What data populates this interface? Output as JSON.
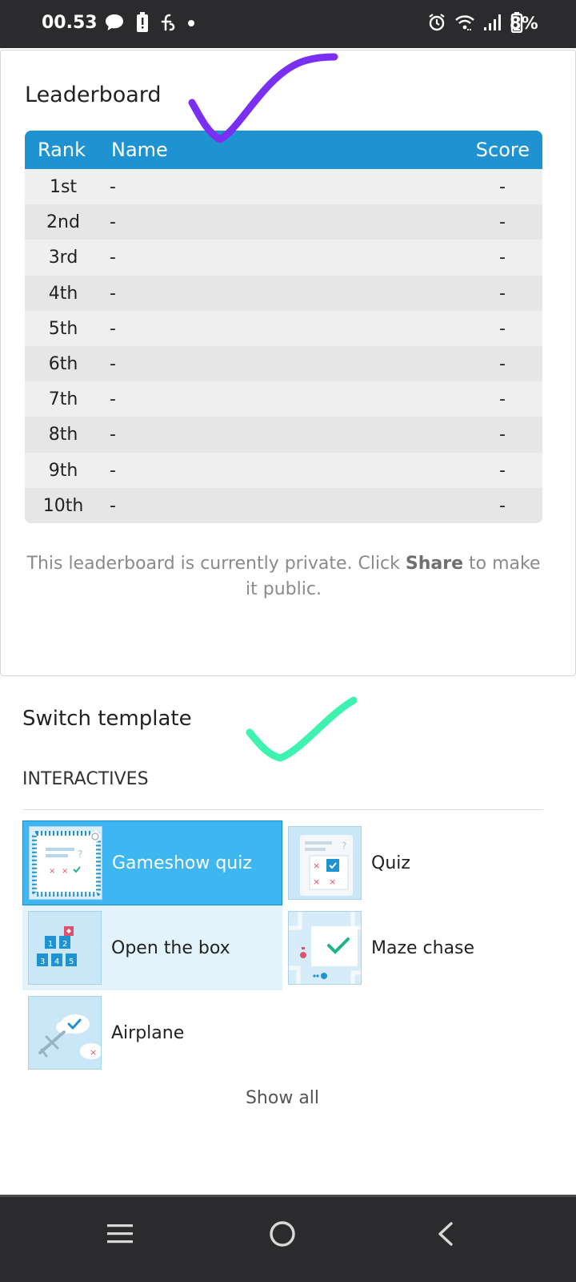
{
  "status_bar": {
    "time": "00.53",
    "battery_percent": "8%",
    "left_icons": [
      "chat-bubble-icon",
      "battery-alert-icon",
      "app-icon",
      "dot-icon"
    ],
    "right_icons": [
      "alarm-icon",
      "wifi-icon",
      "signal-icon",
      "battery-icon"
    ]
  },
  "leaderboard": {
    "title": "Leaderboard",
    "columns": {
      "rank": "Rank",
      "name": "Name",
      "score": "Score"
    },
    "rows": [
      {
        "rank": "1st",
        "name": "-",
        "score": "-"
      },
      {
        "rank": "2nd",
        "name": "-",
        "score": "-"
      },
      {
        "rank": "3rd",
        "name": "-",
        "score": "-"
      },
      {
        "rank": "4th",
        "name": "-",
        "score": "-"
      },
      {
        "rank": "5th",
        "name": "-",
        "score": "-"
      },
      {
        "rank": "6th",
        "name": "-",
        "score": "-"
      },
      {
        "rank": "7th",
        "name": "-",
        "score": "-"
      },
      {
        "rank": "8th",
        "name": "-",
        "score": "-"
      },
      {
        "rank": "9th",
        "name": "-",
        "score": "-"
      },
      {
        "rank": "10th",
        "name": "-",
        "score": "-"
      }
    ],
    "note_before": "This leaderboard is currently private. Click ",
    "note_bold": "Share",
    "note_after": " to make it public."
  },
  "switch_template": {
    "title": "Switch template",
    "section_label": "INTERACTIVES",
    "templates": [
      {
        "label": "Gameshow quiz",
        "icon": "gameshow-quiz-icon",
        "selected": true
      },
      {
        "label": "Quiz",
        "icon": "quiz-icon",
        "selected": false
      },
      {
        "label": "Open the box",
        "icon": "open-the-box-icon",
        "selected": false
      },
      {
        "label": "Maze chase",
        "icon": "maze-chase-icon",
        "selected": false
      },
      {
        "label": "Airplane",
        "icon": "airplane-icon",
        "selected": false
      }
    ],
    "show_all": "Show all"
  },
  "annotations": {
    "check_colors": [
      "#7b2ff2",
      "#3ef2b0"
    ]
  },
  "nav_bar": {
    "buttons": [
      "recent-apps-icon",
      "home-icon",
      "back-icon"
    ]
  },
  "colors": {
    "table_header": "#1f93d2",
    "selected_template": "#3db6f2",
    "status_bar": "#2b2b2e"
  }
}
